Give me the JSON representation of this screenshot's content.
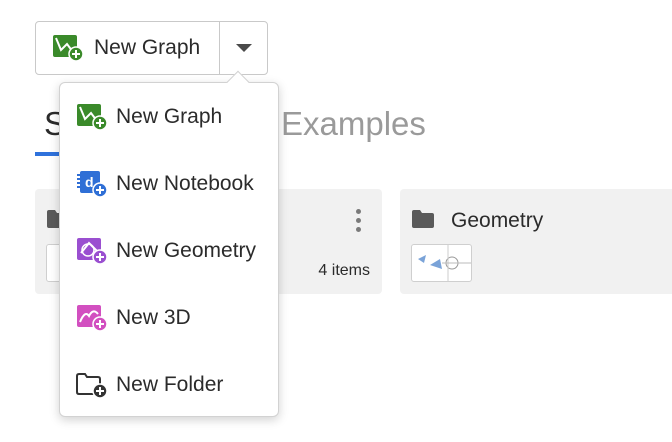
{
  "split_button": {
    "label": "New Graph"
  },
  "tabs": [
    {
      "label": "S"
    },
    {
      "label": "Examples"
    }
  ],
  "menu": {
    "items": [
      {
        "label": "New Graph",
        "icon": "graph-add-icon",
        "color": "#3a8a2a"
      },
      {
        "label": "New Notebook",
        "icon": "notebook-add-icon",
        "color": "#2f6fd6"
      },
      {
        "label": "New Geometry",
        "icon": "geometry-add-icon",
        "color": "#9a4fd0"
      },
      {
        "label": "New 3D",
        "icon": "3d-add-icon",
        "color": "#d24fc0"
      },
      {
        "label": "New Folder",
        "icon": "folder-add-icon",
        "color": "#333333"
      }
    ]
  },
  "folders": [
    {
      "title": "",
      "count": "4 items"
    },
    {
      "title": "Geometry",
      "count": ""
    }
  ],
  "colors": {
    "accent": "#2f72dc",
    "card_bg": "#f1f1f1"
  }
}
